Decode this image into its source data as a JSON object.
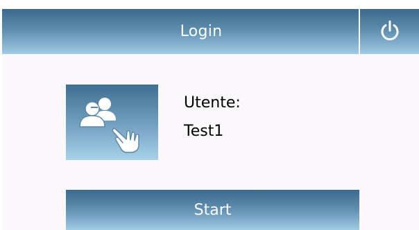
{
  "header": {
    "title": "Login",
    "power_icon": "power-icon"
  },
  "user": {
    "icon": "users-touch-icon",
    "label": "Utente:",
    "value": "Test1"
  },
  "actions": {
    "start_label": "Start"
  },
  "colors": {
    "bar_top": "#3b6a8e",
    "bar_bottom": "#9fcbe3",
    "panel_bg": "#fbf8fb",
    "text_light": "#ffffff",
    "text_dark": "#000000"
  }
}
